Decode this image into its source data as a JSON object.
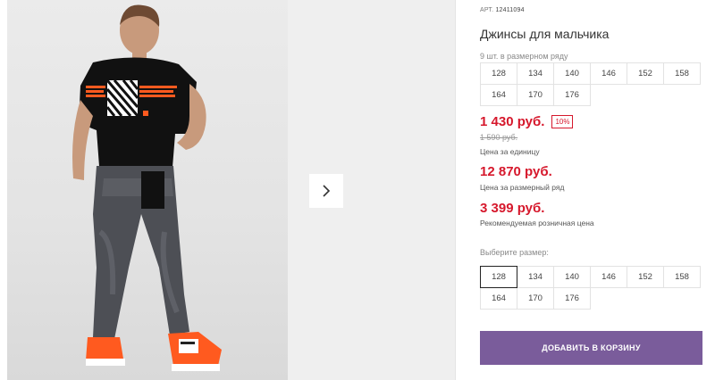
{
  "gallery": {
    "next_icon": "chevron-right-icon",
    "shirt_print": "",
    "shoe_text": ""
  },
  "product": {
    "sku_label": "АРТ.",
    "sku_value": "12411094",
    "title": "Джинсы для мальчика",
    "size_count_text": "9 шт. в размерном ряду",
    "size_row": [
      [
        "128",
        "134",
        "140",
        "146",
        "152",
        "158"
      ],
      [
        "164",
        "170",
        "176"
      ]
    ],
    "price_unit": "1 430 руб.",
    "discount": "10%",
    "old_price": "1 590 руб.",
    "price_unit_label": "Цена за единицу",
    "price_row": "12 870 руб.",
    "price_row_label": "Цена за размерный ряд",
    "price_rrp": "3 399 руб.",
    "price_rrp_label": "Рекомендуемая розничная цена",
    "choose_size_label": "Выберите размер:",
    "selected_size": "128",
    "add_to_cart": "ДОБАВИТЬ В КОРЗИНУ"
  },
  "colors": {
    "price_red": "#d6182c",
    "button_purple": "#7a5c9b"
  }
}
